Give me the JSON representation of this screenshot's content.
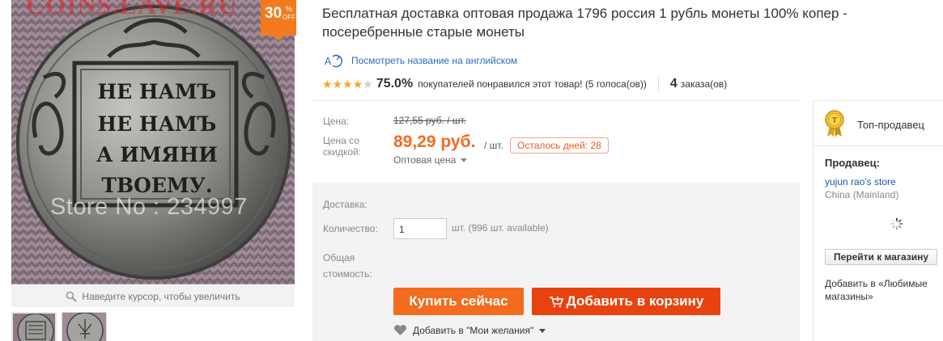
{
  "gallery": {
    "watermark": "COINS.LAVE.RU",
    "discount_percent": "30",
    "discount_sign": "%",
    "discount_off": "OFF",
    "coin_lines": [
      "НЕ НАМЪ",
      "НЕ НАМЪ",
      "А ИМЯНИ",
      "ТВОЕМУ."
    ],
    "store_watermark": "Store No : 234997",
    "zoom_hint": "Наведите курсор, чтобы увеличить"
  },
  "product": {
    "title": "Бесплатная доставка оптовая продажа 1796 россия 1 рубль монеты 100% копер - посеребренные старые монеты",
    "translate_link": "Посмотреть название на английском",
    "rating_stars": 4,
    "rating_percent": "75.0%",
    "rating_text": "покупателей понравился этот товар! (5 голоса(ов))",
    "orders_count": "4",
    "orders_text": "заказа(ов)"
  },
  "price": {
    "price_label": "Цена:",
    "old_price": "127,55 руб. / шт.",
    "discount_label": "Цена со скидкой:",
    "new_price": "89,29 руб.",
    "unit": "/ шт.",
    "days_left": "Осталось дней: 28",
    "wholesale": "Оптовая цена"
  },
  "order": {
    "delivery_label": "Доставка:",
    "qty_label": "Количество:",
    "qty_value": "1",
    "qty_info": "шт. (996 шт. available)",
    "total_label": "Общая стоимость:",
    "buy_now": "Купить сейчас",
    "add_to_cart": "Добавить в корзину",
    "wishlist": "Добавить в \"Мои желания\""
  },
  "seller": {
    "badge_letter": "T",
    "top_seller": "Топ-продавец",
    "seller_label": "Продавец:",
    "store_name": "yujun rao's store",
    "store_country": "China (Mainland)",
    "go_to_store": "Перейти к магазину",
    "add_favorites": "Добавить в «Любимые магазины»"
  },
  "colors": {
    "accent_orange": "#f36b1d",
    "cart_red": "#e8420f",
    "link_blue": "#1b5a9e",
    "star_gold": "#f5a623"
  }
}
